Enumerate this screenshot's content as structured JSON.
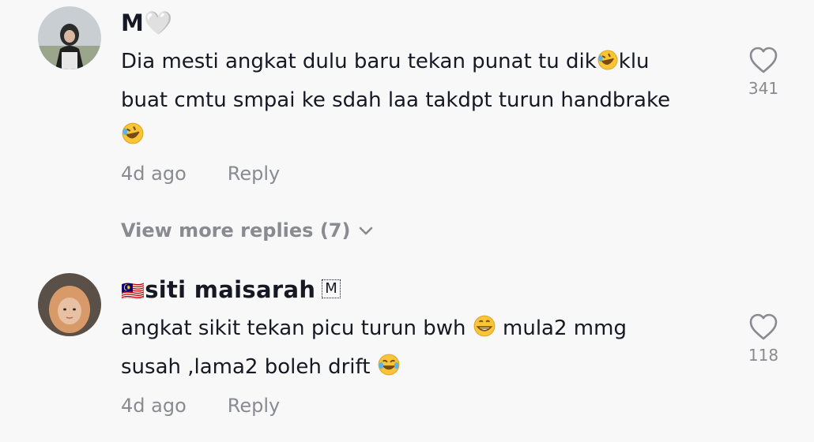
{
  "comments": [
    {
      "username": "M🤍",
      "text_line1": "Dia mesti angkat dulu baru tekan punat tu dik",
      "text_line1_tail": "klu",
      "text_line2": "buat cmtu smpai ke sdah laa takdpt turun handbrake",
      "time": "4d ago",
      "reply_label": "Reply",
      "like_count": "341"
    },
    {
      "flag": "🇲🇾",
      "username": "siti maisarah",
      "badge": "M",
      "text_line1": "angkat sikit tekan picu turun bwh",
      "text_line1_tail": "mula2 mmg",
      "text_line2": "susah ,lama2 boleh drift",
      "time": "4d ago",
      "reply_label": "Reply",
      "like_count": "118"
    }
  ],
  "view_more_replies": "View more replies (7)",
  "icons": {
    "heart": "heart-outline-icon",
    "rofl": "rolling-on-floor-laughing-emoji",
    "grin": "grinning-emoji",
    "joy": "tears-of-joy-emoji",
    "chevron": "chevron-down-icon"
  },
  "colors": {
    "background": "#f8f8f8",
    "text": "#161823",
    "muted": "#8a8b91"
  }
}
